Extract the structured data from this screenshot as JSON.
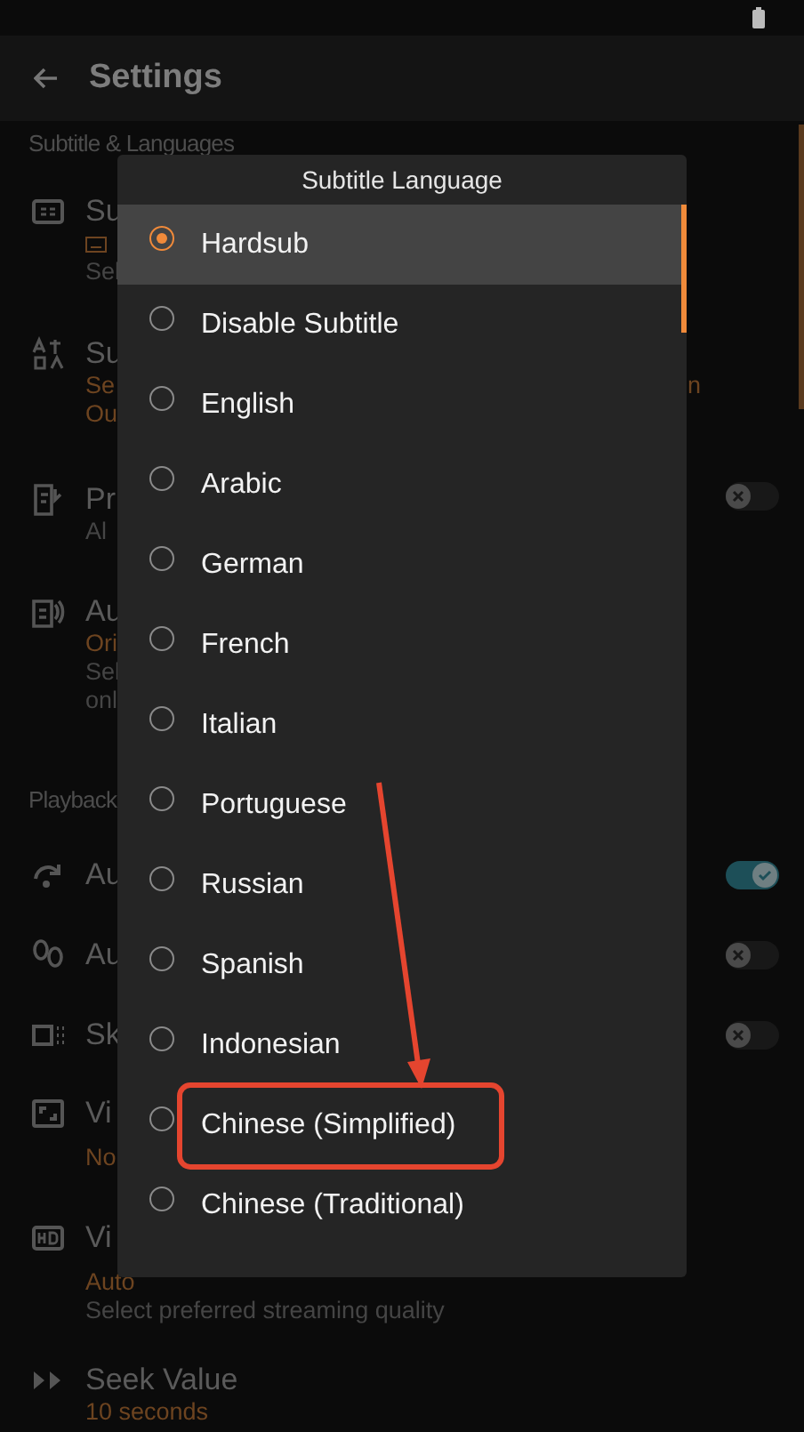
{
  "header": {
    "title": "Settings"
  },
  "sections": [
    {
      "title": "Subtitle & Languages",
      "rows": [
        {
          "title": "Su",
          "lines": [
            {
              "kind": "icon_value"
            },
            {
              "kind": "hint",
              "text": "Sel"
            }
          ]
        },
        {
          "title": "Su",
          "lines": [
            {
              "kind": "value",
              "text": "Se",
              "trail": "n"
            },
            {
              "kind": "value",
              "text": "Ou"
            }
          ]
        },
        {
          "title": "Pr",
          "lines": [
            {
              "kind": "hint",
              "text": "Al"
            }
          ],
          "toggle": {
            "on": false
          }
        },
        {
          "title": "Au",
          "lines": [
            {
              "kind": "value",
              "text": "Ori"
            },
            {
              "kind": "hint",
              "text": "Sel"
            },
            {
              "kind": "hint",
              "text": "onl"
            }
          ]
        }
      ]
    },
    {
      "title": "Playback",
      "rows": [
        {
          "title": "Au",
          "lines": [],
          "toggle": {
            "on": true
          }
        },
        {
          "title": "Au",
          "lines": [],
          "toggle": {
            "on": false
          }
        },
        {
          "title": "Sk",
          "lines": [],
          "toggle": {
            "on": false
          }
        },
        {
          "title": "Vi",
          "lines": [
            {
              "kind": "value",
              "text": "No"
            }
          ]
        },
        {
          "title": "Vi",
          "lines": [
            {
              "kind": "value",
              "text": "Auto"
            },
            {
              "kind": "hint",
              "text": "Select preferred streaming quality"
            }
          ]
        },
        {
          "title": "Seek Value",
          "lines": [
            {
              "kind": "value",
              "text": "10 seconds"
            }
          ]
        }
      ]
    }
  ],
  "dialog": {
    "title": "Subtitle Language",
    "options": [
      {
        "label": "Hardsub",
        "selected": true
      },
      {
        "label": "Disable Subtitle",
        "selected": false
      },
      {
        "label": "English",
        "selected": false
      },
      {
        "label": "Arabic",
        "selected": false
      },
      {
        "label": "German",
        "selected": false
      },
      {
        "label": "French",
        "selected": false
      },
      {
        "label": "Italian",
        "selected": false
      },
      {
        "label": "Portuguese",
        "selected": false
      },
      {
        "label": "Russian",
        "selected": false
      },
      {
        "label": "Spanish",
        "selected": false
      },
      {
        "label": "Indonesian",
        "selected": false
      },
      {
        "label": "Chinese (Simplified)",
        "selected": false
      },
      {
        "label": "Chinese (Traditional)",
        "selected": false
      }
    ]
  }
}
